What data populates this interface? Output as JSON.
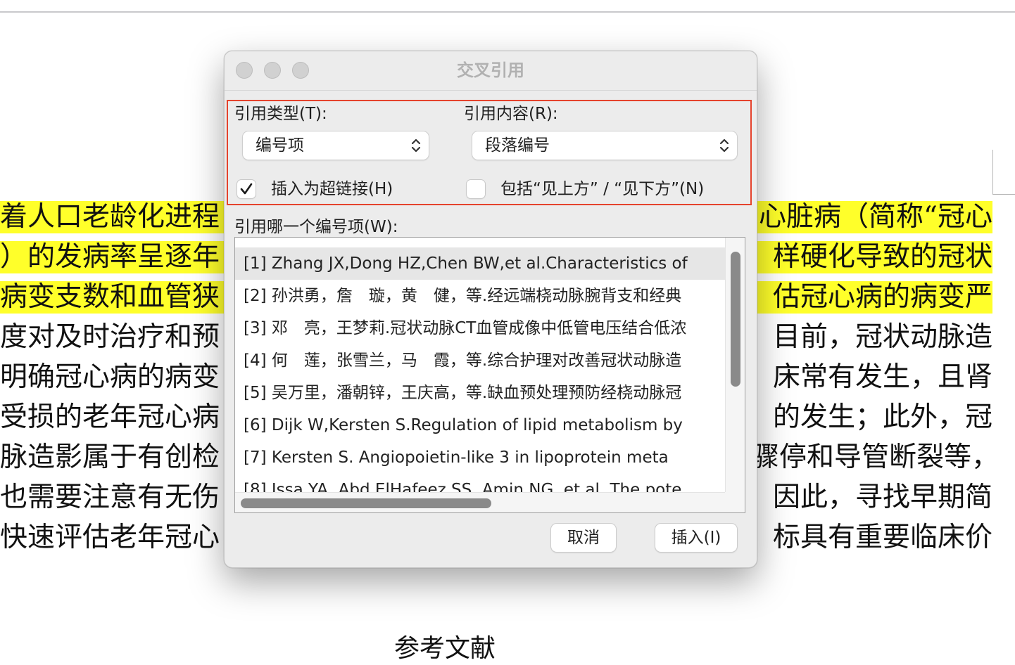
{
  "document": {
    "lines": [
      {
        "left": "着人口老龄化进程",
        "right": "心脏病（简称“冠心",
        "highlighted": true
      },
      {
        "left": "）的发病率呈逐年",
        "right": "样硬化导致的冠状",
        "highlighted": true
      },
      {
        "left": "病变支数和血管狭",
        "right": "估冠心病的病变严",
        "highlighted": true
      },
      {
        "left": "度对及时治疗和预",
        "right": "目前，冠状动脉造",
        "highlighted": false
      },
      {
        "left": "明确冠心病的病变",
        "right": "床常有发生，且肾",
        "highlighted": false
      },
      {
        "left": "受损的老年冠心病",
        "right": "的发生；此外，冠",
        "highlighted": false
      },
      {
        "left": "脉造影属于有创检",
        "right": "骤停和导管断裂等，",
        "highlighted": false
      },
      {
        "left": "也需要注意有无伤",
        "right": "因此，寻找早期简",
        "highlighted": false
      },
      {
        "left": "快速评估老年冠心",
        "right": "标具有重要临床价",
        "highlighted": false
      }
    ],
    "references_heading": "参考文献"
  },
  "dialog": {
    "title": "交叉引用",
    "ref_type_label": "引用类型(T):",
    "ref_type_value": "编号项",
    "ref_content_label": "引用内容(R):",
    "ref_content_value": "段落编号",
    "hyperlink_label": "插入为超链接(H)",
    "hyperlink_checked": true,
    "above_below_label": "包括“见上方” / “见下方”(N)",
    "above_below_checked": false,
    "list_label": "引用哪一个编号项(W):",
    "items": [
      "[1] Zhang JX,Dong HZ,Chen BW,et al.Characteristics of",
      "[2] 孙洪勇，詹　璇，黄　健，等.经远端桡动脉腕背支和经典",
      "[3] 邓　亮，王梦莉.冠状动脉CT血管成像中低管电压结合低浓",
      "[4] 何　莲，张雪兰，马　霞，等.综合护理对改善冠状动脉造",
      "[5] 吴万里，潘朝锌，王庆高，等.缺血预处理预防经桡动脉冠",
      "[6] Dijk W,Kersten S.Regulation of lipid metabolism by",
      "[7] Kersten S. Angiopoietin-like 3 in lipoprotein meta",
      "[8] Issa YA, Abd ElHafeez SS, Amin NG, et al. The pote"
    ],
    "selected_index": 0,
    "cancel_label": "取消",
    "insert_label": "插入(I)",
    "colors": {
      "highlight": "#ffff2a",
      "annotation_box": "#e5432d"
    }
  }
}
